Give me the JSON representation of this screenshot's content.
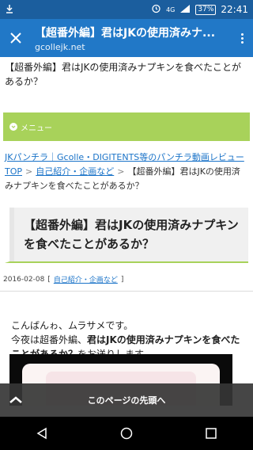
{
  "status_bar": {
    "download_icon": "download-icon",
    "alarm_icon": "alarm-icon",
    "network": "4G",
    "battery": "37%",
    "time": "22:41"
  },
  "toolbar": {
    "title": "【超番外編】君はJKの使用済みナ...",
    "url": "gcollejk.net"
  },
  "page": {
    "lead_text": "【超番外編】君はJKの使用済みナプキンを食べたことがあるか？",
    "menu_label": "メニュー",
    "breadcrumb": {
      "site": "JKパンチラ｜Gcolle・DIGITENTS等のパンチラ動画レビュー",
      "top": "TOP",
      "category": "自己紹介・企画など",
      "current": "【超番外編】君はJKの使用済みナプキンを食べたことがあるか？"
    },
    "article_title": "【超番外編】君はJKの使用済みナプキンを食べたことがあるか？",
    "date": "2016-02-08",
    "meta_category": "自己紹介・企画など",
    "body_line1": "こんばんゎ、ムラサメです。",
    "body_line2_prefix": "今夜は超番外編、",
    "body_line2_strong": "君はJKの使用済みナプキンを食べたことがあるか？",
    "body_line2_suffix": "をお送りします。"
  },
  "back_to_top": "このページの先頭へ",
  "nav": {
    "back": "back-icon",
    "home": "home-icon",
    "recents": "recents-icon"
  }
}
